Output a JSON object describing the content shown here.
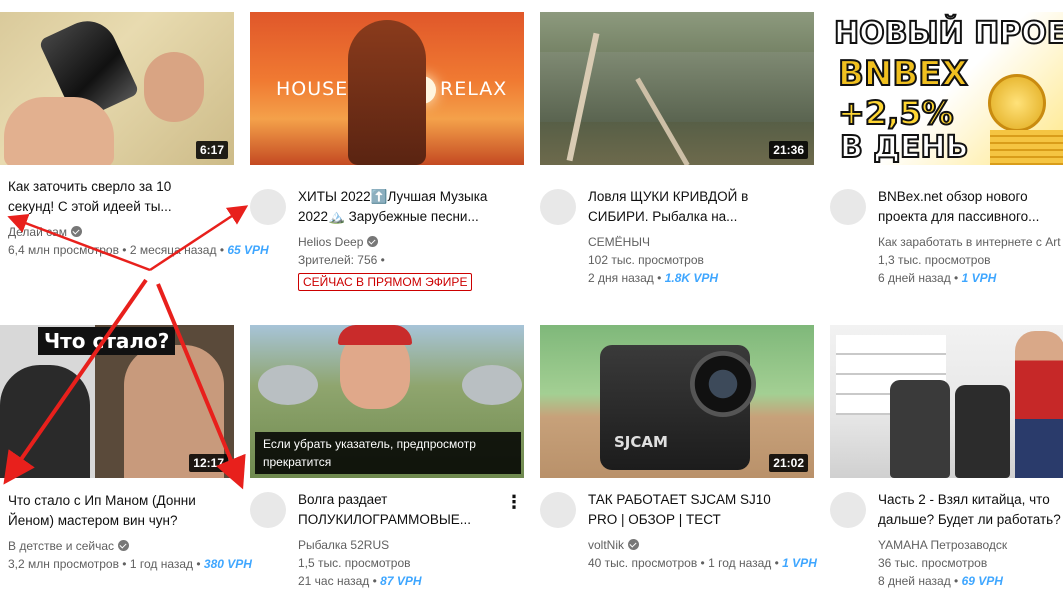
{
  "videos": [
    {
      "title": "Как заточить сверло за 10 секунд! С этой идеей ты...",
      "channel": "Делай сам",
      "verified": true,
      "views": "6,4 млн просмотров",
      "age": "2 месяца назад",
      "vph": "65 VPH",
      "duration": "6:17"
    },
    {
      "title": "ХИТЫ 2022⬆️Лучшая Музыка 2022🏔️ Зарубежные песни...",
      "channel": "Helios Deep",
      "verified": true,
      "viewers": "Зрителей: 756",
      "live_badge": "СЕЙЧАС В ПРЯМОМ ЭФИРЕ",
      "thumb_left_text": "HOUSE",
      "thumb_right_text": "RELAX"
    },
    {
      "title": "Ловля ЩУКИ КРИВДОЙ в СИБИРИ. Рыбалка на...",
      "channel": "СЕМЁНЫЧ",
      "verified": false,
      "views": "102 тыс. просмотров",
      "age": "2 дня назад",
      "vph": "1.8K VPH",
      "duration": "21:36"
    },
    {
      "title": "BNBex.net обзор нового проекта для пассивного...",
      "channel": "Как заработать в интернете с Art",
      "verified": false,
      "views": "1,3 тыс. просмотров",
      "age": "6 дней назад",
      "vph": "1 VPH",
      "thumb_line1": "НОВЫЙ ПРОЕК",
      "thumb_line2": "BNBEX",
      "thumb_line3": "+2,5%",
      "thumb_line4": "В ДЕНЬ"
    },
    {
      "title": "Что стало с Ип Маном (Донни Йеном) мастером вин чун?",
      "channel": "В детстве и сейчас",
      "verified": true,
      "views": "3,2 млн просмотров",
      "age": "1 год назад",
      "vph": "380 VPH",
      "duration": "12:17",
      "thumb_text": "Что стало?"
    },
    {
      "title": "Волга раздает ПОЛУКИЛОГРАММОВЫЕ...",
      "channel": "Рыбалка 52RUS",
      "verified": false,
      "views": "1,5 тыс. просмотров",
      "age": "21 час назад",
      "vph": "87 VPH",
      "tooltip": "Если убрать указатель, предпросмотр прекратится",
      "more": "⋮"
    },
    {
      "title": "ТАК РАБОТАЕТ SJCAM SJ10 PRO | ОБЗОР | ТЕСТ",
      "channel": "voltNik",
      "verified": true,
      "views": "40 тыс. просмотров",
      "age": "1 год назад",
      "vph": "1 VPH",
      "duration": "21:02",
      "thumb_brand": "SJCAM"
    },
    {
      "title": "Часть 2 - Взял китайца, что дальше? Будет ли работать?",
      "channel": "YAMAHA Петрозаводск",
      "verified": false,
      "views": "36 тыс. просмотров",
      "age": "8 дней назад",
      "vph": "69 VPH"
    }
  ]
}
